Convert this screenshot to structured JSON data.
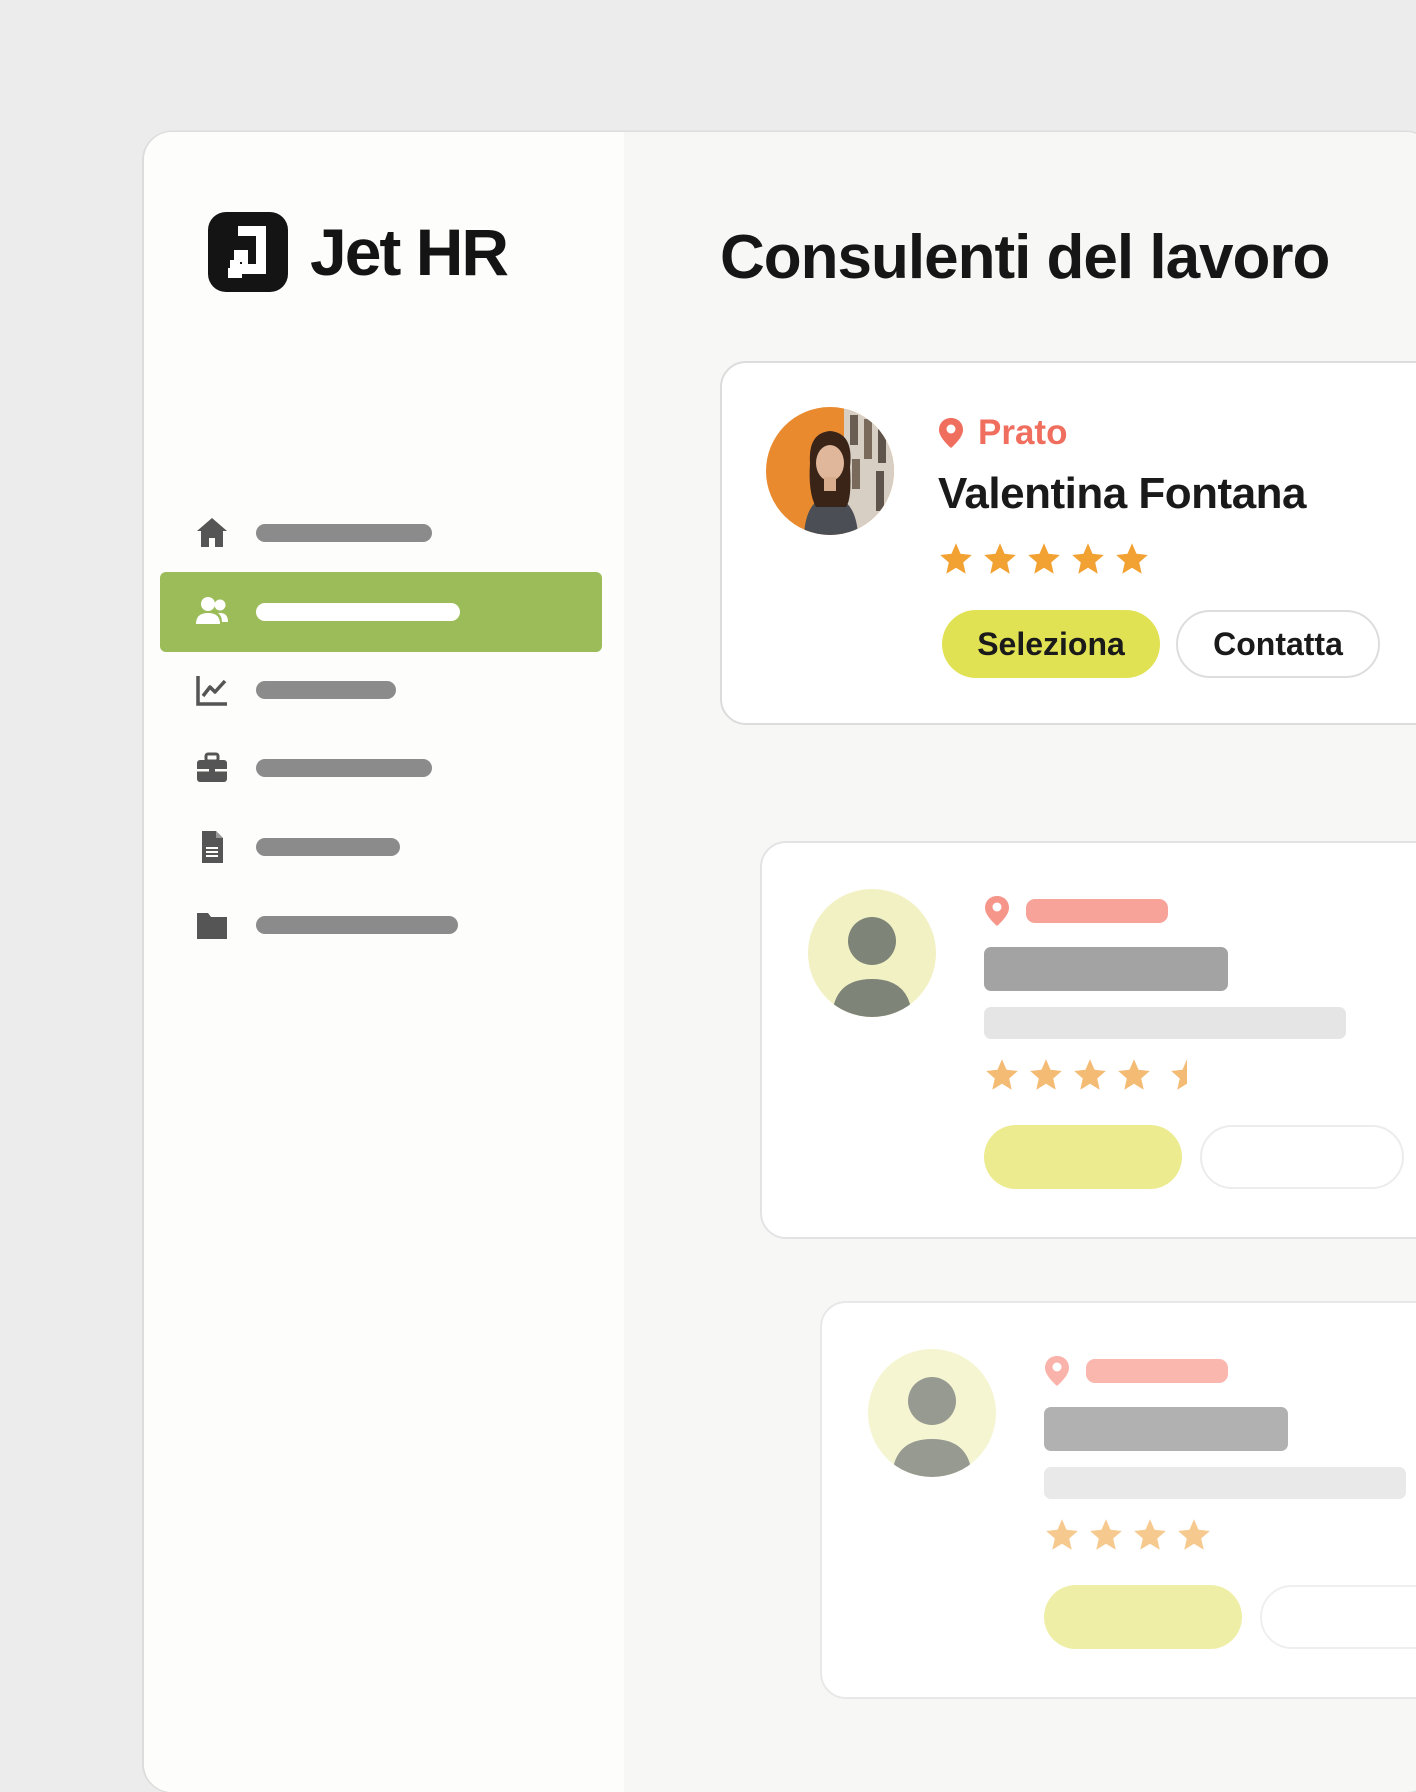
{
  "brand": {
    "name": "Jet HR"
  },
  "page": {
    "title": "Consulenti del lavoro"
  },
  "sidebar": {
    "items": [
      {
        "icon": "home-icon",
        "active": false
      },
      {
        "icon": "users-icon",
        "active": true
      },
      {
        "icon": "chart-line-icon",
        "active": false
      },
      {
        "icon": "briefcase-icon",
        "active": false
      },
      {
        "icon": "document-icon",
        "active": false
      },
      {
        "icon": "folder-icon",
        "active": false
      }
    ]
  },
  "consultants": [
    {
      "location": "Prato",
      "name": "Valentina Fontana",
      "rating": 5,
      "select_label": "Seleziona",
      "contact_label": "Contatta"
    },
    {
      "placeholder": true,
      "rating": 4.5
    },
    {
      "placeholder": true,
      "rating": 4
    }
  ],
  "colors": {
    "accent_green": "#9cbc5a",
    "button_yellow": "#e1e154",
    "location_red": "#f06e5e",
    "star_orange": "#f2a232"
  }
}
